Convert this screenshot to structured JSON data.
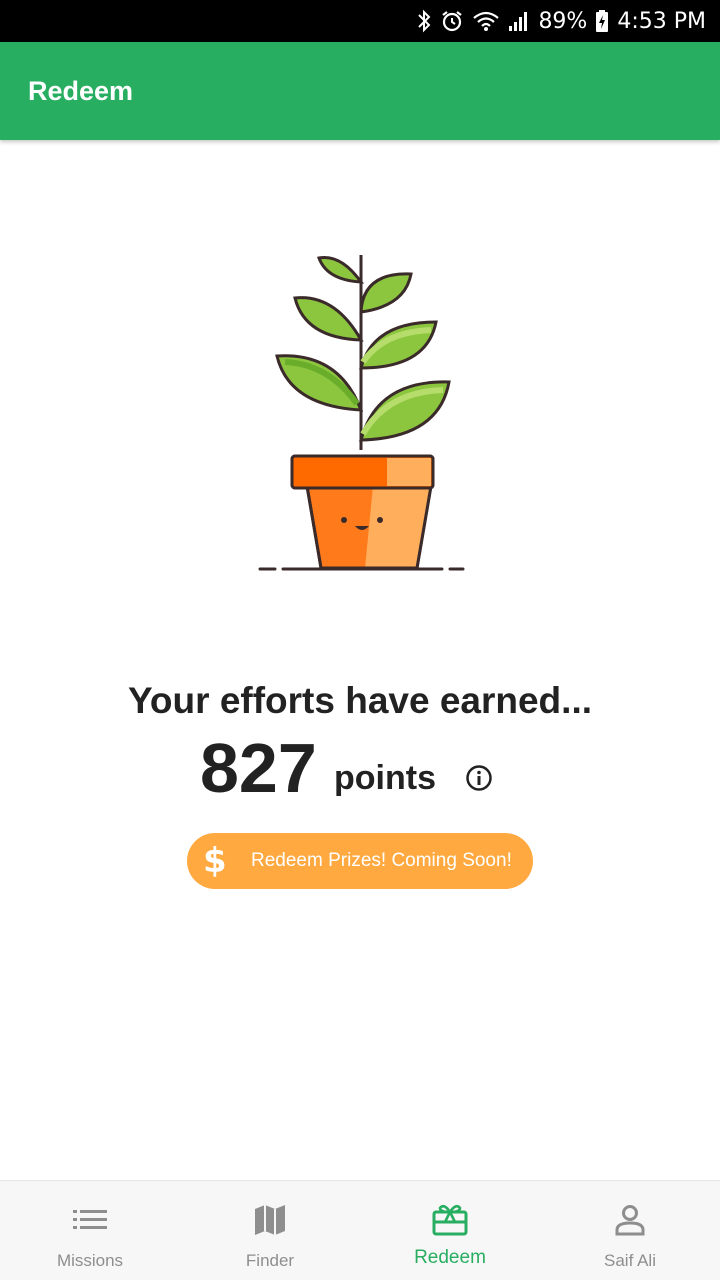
{
  "status_bar": {
    "battery": "89%",
    "time": "4:53 PM"
  },
  "app_bar": {
    "title": "Redeem"
  },
  "summary": {
    "heading": "Your efforts have earned...",
    "points_value": "827",
    "points_unit": "points"
  },
  "redeem_button": {
    "icon": "$",
    "label": "Redeem Prizes! Coming Soon!"
  },
  "bottom_nav": {
    "items": [
      {
        "label": "Missions",
        "icon": "list-icon"
      },
      {
        "label": "Finder",
        "icon": "map-icon"
      },
      {
        "label": "Redeem",
        "icon": "gift-card-icon",
        "active": true
      },
      {
        "label": "Saif Ali",
        "icon": "person-icon"
      }
    ]
  },
  "colors": {
    "primary": "#27ae60",
    "accent": "#ffa940",
    "text": "#222222",
    "inactive": "#8e8e8e"
  }
}
